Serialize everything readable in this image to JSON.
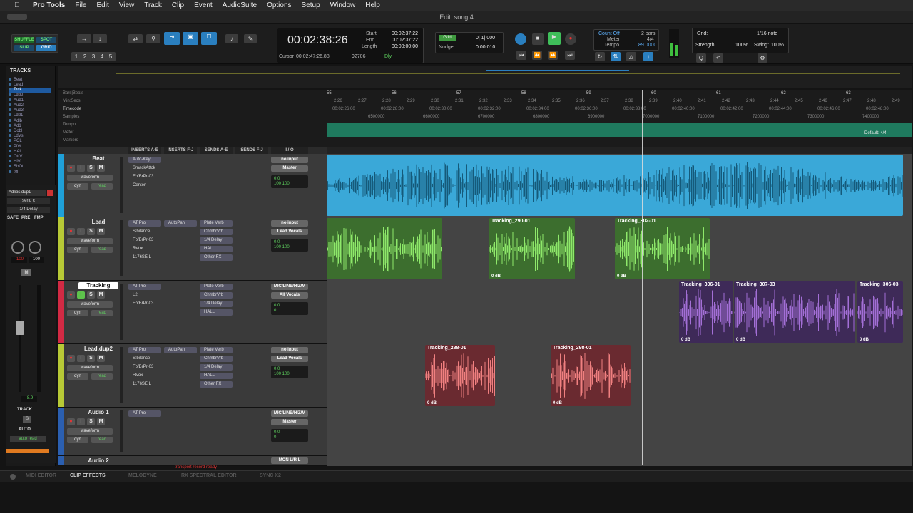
{
  "menubar": {
    "app_name": "Pro Tools",
    "items": [
      "File",
      "Edit",
      "View",
      "Track",
      "Clip",
      "Event",
      "AudioSuite",
      "Options",
      "Setup",
      "Window",
      "Help"
    ]
  },
  "window": {
    "title": "Edit: song 4"
  },
  "toolbar": {
    "modes": [
      "SHUFFLE",
      "SPOT",
      "SLIP",
      "GRID"
    ],
    "zoom_presets": [
      "1",
      "2",
      "3",
      "4",
      "5"
    ],
    "main_counter": "00:02:38:26",
    "start_label": "Start",
    "start": "00:02:37:22",
    "end_label": "End",
    "end": "00:02:37:22",
    "length_label": "Length",
    "length": "00:00:00:00",
    "cursor_label": "Cursor",
    "cursor": "00:02:47:26.88",
    "cursor_samples": "92706",
    "dly_label": "Dly",
    "grid_label": "Grid",
    "grid_value": "0| 1| 000",
    "nudge_label": "Nudge",
    "nudge_value": "0:00.010",
    "count_off": "Count Off",
    "meter_label": "Meter",
    "meter_value": "4/4",
    "tempo_label": "Tempo",
    "tempo_value": "89.0000",
    "count_bars": "2 bars",
    "grid_note_label": "Grid:",
    "grid_note": "1/16 note",
    "strength_label": "Strength:",
    "strength": "100%",
    "swing_label": "Swing:",
    "swing": "100%"
  },
  "tracks_panel": {
    "title": "TRACKS",
    "items": [
      "Beat",
      "Lead",
      "Trck",
      "Ldd2",
      "Aud1",
      "Aud2",
      "Aud3",
      "Ldd1",
      "Adlb",
      "Ad1",
      "Dobl",
      "LdVs",
      "PCL",
      "PiVr",
      "HAL",
      "OtrV",
      "HiVr",
      "SbOt",
      "f/fl"
    ],
    "selected_index": 2
  },
  "rulers": {
    "labels": [
      "Bars|Beats",
      "Min:Secs",
      "Timecode",
      "Samples",
      "Tempo",
      "Meter",
      "Markers"
    ],
    "bars": [
      "55",
      "56",
      "57",
      "58",
      "59",
      "60",
      "61",
      "62",
      "63"
    ],
    "minsecs": [
      "2:26",
      "2:27",
      "2:28",
      "2:29",
      "2:30",
      "2:31",
      "2:32",
      "2:33",
      "2:34",
      "2:35",
      "2:36",
      "2:37",
      "2:38",
      "2:39",
      "2:40",
      "2:41",
      "2:42",
      "2:43",
      "2:44",
      "2:45",
      "2:46",
      "2:47",
      "2:48",
      "2:49"
    ],
    "timecode": [
      "00:02:26:00",
      "00:02:28:00",
      "00:02:30:00",
      "00:02:32:00",
      "00:02:34:00",
      "00:02:36:00",
      "00:02:38:00",
      "00:02:40:00",
      "00:02:42:00",
      "00:02:44:00",
      "00:02:46:00",
      "00:02:48:00"
    ],
    "samples": [
      "6500000",
      "6600000",
      "6700000",
      "6800000",
      "6900000",
      "7000000",
      "7100000",
      "7200000",
      "7300000",
      "7400000"
    ],
    "meter_default": "Default: 4/4"
  },
  "columns": [
    "INSERTS A-E",
    "INSERTS F-J",
    "SENDS A-E",
    "SENDS F-J",
    "I / O"
  ],
  "tracks": [
    {
      "name": "Beat",
      "view": "waveform",
      "mode": "dyn",
      "read": "read",
      "inserts": [
        "Auto-Key",
        "SmackAttck",
        "FbfBrPr-03",
        "Center"
      ],
      "sends": [],
      "io_in": "no input",
      "io_out": "Master",
      "vol": "0.0",
      "pan": "100  100",
      "color": "#1fa0d8"
    },
    {
      "name": "Lead",
      "view": "waveform",
      "mode": "dyn",
      "read": "read",
      "inserts": [
        "AT Pro",
        "Sibilance",
        "FbfBrPr-03",
        "RVox",
        "1176SE L"
      ],
      "inserts_fj": [
        "AutoPan"
      ],
      "sends": [
        "Plate Verb",
        "ChmbrVrb",
        "1/4 Delay",
        "HALL",
        "Other FX"
      ],
      "io_in": "no input",
      "io_out": "Lead Vocals",
      "vol": "0.0",
      "pan": "100  100",
      "color": "#b7c936"
    },
    {
      "name": "Tracking",
      "view": "waveform",
      "mode": "dyn",
      "read": "read",
      "inserts": [
        "AT Pro",
        "L2",
        "FbfBrPr-03"
      ],
      "sends": [
        "Plate Verb",
        "ChmbrVrb",
        "1/4 Delay",
        "HALL"
      ],
      "io_in": "MIC/LINE/HIZ/M",
      "io_out": "All Vocals",
      "vol": "0.0",
      "pan": "0",
      "color": "#d22a44"
    },
    {
      "name": "Lead.dup2",
      "view": "waveform",
      "mode": "dyn",
      "read": "read",
      "inserts": [
        "AT Pro",
        "Sibilance",
        "FbfBrPr-03",
        "RVox",
        "1176SE L"
      ],
      "inserts_fj": [
        "AutoPan"
      ],
      "sends": [
        "Plate Verb",
        "ChmbrVrb",
        "1/4 Delay",
        "HALL",
        "Other FX"
      ],
      "io_in": "no input",
      "io_out": "Lead Vocals",
      "vol": "0.0",
      "pan": "100  100",
      "color": "#b7c936"
    },
    {
      "name": "Audio 1",
      "view": "waveform",
      "mode": "dyn",
      "read": "read",
      "inserts": [
        "AT Pro"
      ],
      "sends": [],
      "io_in": "MIC/LINE/HIZ/M",
      "io_out": "Master",
      "vol": "0.0",
      "pan": "0",
      "color": "#2b5fb0"
    },
    {
      "name": "Audio 2",
      "io_in": "MON L/R L",
      "color": "#2b5fb0"
    }
  ],
  "clips": {
    "lead": [
      {
        "name": "Tracking_290-01",
        "gain": "0 dB"
      },
      {
        "name": "Tracking_302-01",
        "gain": "0 dB"
      }
    ],
    "tracking": [
      {
        "name": "Tracking_306-01",
        "gain": "0 dB"
      },
      {
        "name": "Tracking_307-03",
        "gain": "0 dB"
      },
      {
        "name": "Tracking_306-03",
        "gain": "0 dB"
      }
    ],
    "leaddup2": [
      {
        "name": "Tracking_288-01",
        "gain": "0 dB"
      },
      {
        "name": "Tracking_298-01",
        "gain": "0 dB"
      }
    ]
  },
  "mixer": {
    "track_name": "Adlibs.dup1",
    "send": "send c",
    "delay": "1/4 Delay",
    "safe": "SAFE",
    "pre": "PRE",
    "fmp": "FMP",
    "pan_l": "-100",
    "pan_r": "100",
    "fader": "-8.9",
    "track_label": "TRACK",
    "s_label": "S",
    "auto_label": "AUTO",
    "auto_mode": "auto read",
    "m_label": "M"
  },
  "status": "transport record ready",
  "bottom_tabs": [
    "MIDI EDITOR",
    "CLIP EFFECTS",
    "MELODYNE",
    "RX SPECTRAL EDITOR",
    "SYNC X2"
  ],
  "bottom_active": 1
}
